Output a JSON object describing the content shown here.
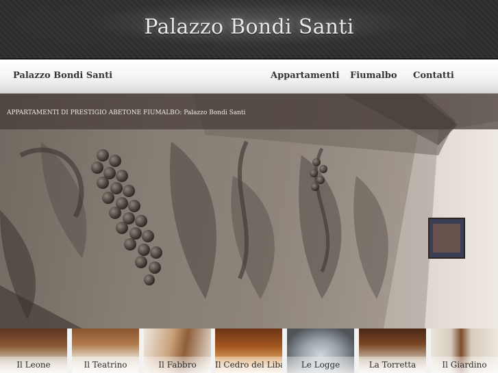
{
  "header": {
    "title": "Palazzo Bondi Santi"
  },
  "nav": {
    "brand": "Palazzo Bondi Santi",
    "links": [
      {
        "label": "Appartamenti"
      },
      {
        "label": "Fiumalbo"
      },
      {
        "label": "Contatti"
      }
    ]
  },
  "hero": {
    "caption": "APPARTAMENTI DI PRESTIGIO ABETONE FIUMALBO: Palazzo Bondi Santi"
  },
  "thumbnails": [
    {
      "label": "Il Leone",
      "color": "#7a4a2a"
    },
    {
      "label": "Il Teatrino",
      "color": "#a0693c"
    },
    {
      "label": "Il Fabbro",
      "color": "#b98b5e"
    },
    {
      "label": "Il Cedro del Libano",
      "color": "#8e4a1e"
    },
    {
      "label": "Le Logge",
      "color": "#6f7478"
    },
    {
      "label": "La Torretta",
      "color": "#6b3e22"
    },
    {
      "label": "Il Giardino",
      "color": "#c9b39a"
    }
  ]
}
